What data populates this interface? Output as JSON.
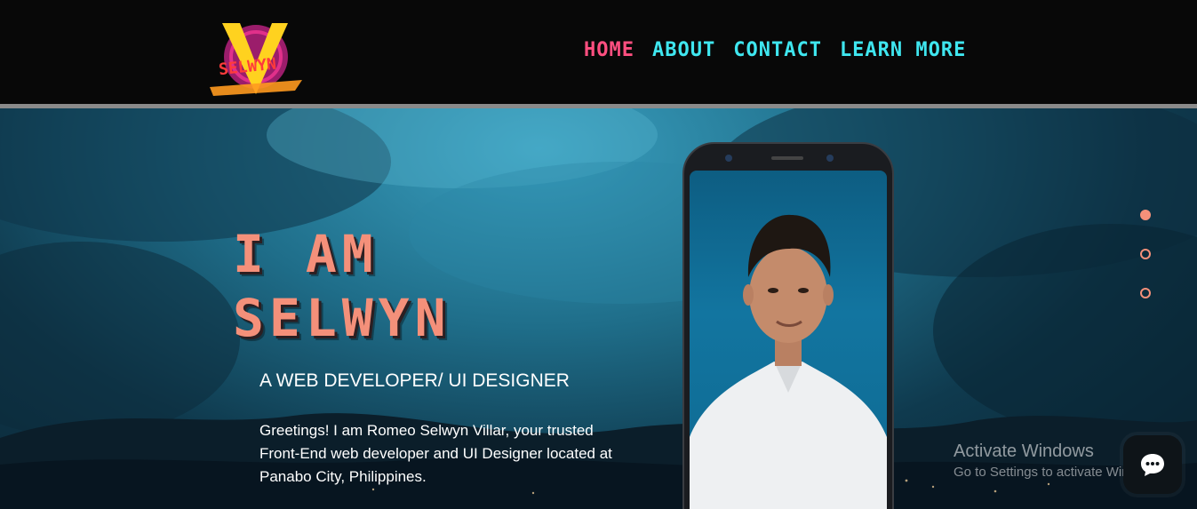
{
  "header": {
    "logo_text": "SELWYN",
    "nav": [
      {
        "label": "HOME",
        "color": "#ff4f80",
        "active": true
      },
      {
        "label": "ABOUT",
        "color": "#3fe6ef",
        "active": false
      },
      {
        "label": "CONTACT",
        "color": "#3fe6ef",
        "active": false
      },
      {
        "label": "LEARN MORE",
        "color": "#3fe6ef",
        "active": false
      }
    ]
  },
  "hero": {
    "title_line1": "I AM",
    "title_line2": "SELWYN",
    "subtitle": "A WEB DEVELOPER/ UI DESIGNER",
    "description": "Greetings! I am Romeo Selwyn Villar, your trusted Front-End web developer and UI Designer located at Panabo City, Philippines.",
    "accent_color": "#f4907a"
  },
  "slides": {
    "count": 3,
    "active_index": 0
  },
  "watermark": {
    "title": "Activate Windows",
    "subtitle": "Go to Settings to activate Windows."
  },
  "chat": {
    "icon": "chat-bubble-icon"
  }
}
